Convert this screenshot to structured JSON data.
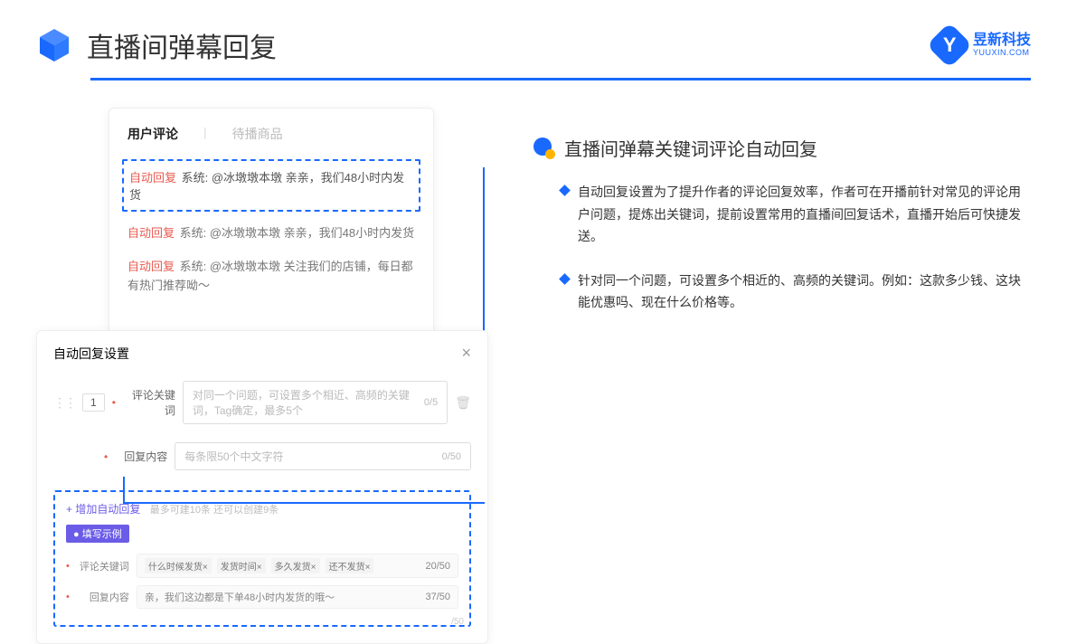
{
  "header": {
    "title": "直播间弹幕回复",
    "logo_cn": "昱新科技",
    "logo_en": "YUUXIN.COM",
    "logo_letter": "Y"
  },
  "comment_panel": {
    "tab_active": "用户评论",
    "tab_inactive": "待播商品",
    "auto_reply_label": "自动回复",
    "highlight": "系统: @冰墩墩本墩 亲亲，我们48小时内发货",
    "row2": "系统: @冰墩墩本墩 亲亲，我们48小时内发货",
    "row3": "系统: @冰墩墩本墩 关注我们的店铺，每日都有热门推荐呦～"
  },
  "settings": {
    "title": "自动回复设置",
    "number": "1",
    "keyword_label": "评论关键词",
    "keyword_placeholder": "对同一个问题，可设置多个相近、高频的关键词，Tag确定，最多5个",
    "keyword_count": "0/5",
    "content_label": "回复内容",
    "content_placeholder": "每条限50个中文字符",
    "content_count": "0/50",
    "add_link": "+ 增加自动回复",
    "add_note": "最多可建10条 还可以创建9条",
    "example_badge": "● 填写示例",
    "example_keyword_label": "评论关键词",
    "example_tags": [
      "什么时候发货×",
      "发货时间×",
      "多久发货×",
      "还不发货×"
    ],
    "example_keyword_count": "20/50",
    "example_content_label": "回复内容",
    "example_content_value": "亲，我们这边都是下单48小时内发货的哦～",
    "example_content_count": "37/50",
    "footer_count": "/50"
  },
  "right": {
    "heading": "直播间弹幕关键词评论自动回复",
    "bullet1": "自动回复设置为了提升作者的评论回复效率，作者可在开播前针对常见的评论用户问题，提炼出关键词，提前设置常用的直播间回复话术，直播开始后可快捷发送。",
    "bullet2": "针对同一个问题，可设置多个相近的、高频的关键词。例如：这款多少钱、这块能优惠吗、现在什么价格等。"
  }
}
